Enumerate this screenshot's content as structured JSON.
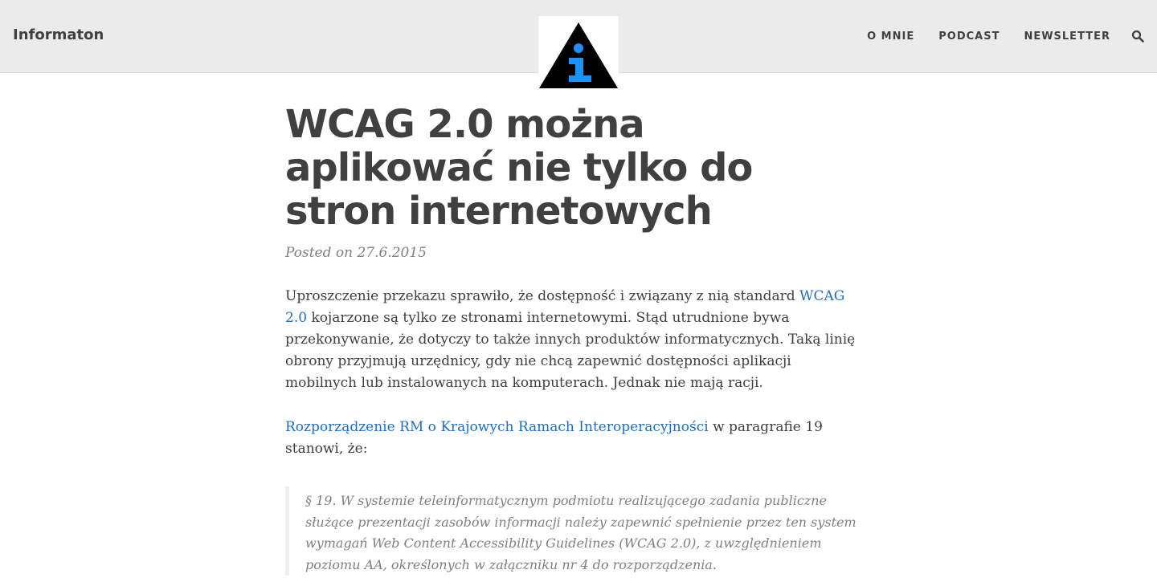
{
  "header": {
    "brand": "Informaton",
    "nav": [
      "O MNIE",
      "PODCAST",
      "NEWSLETTER"
    ],
    "search_icon": "search-icon",
    "logo_icon": "info-triangle-icon"
  },
  "post": {
    "title": "WCAG 2.0 można aplikować nie tylko do stron internetowych",
    "meta": "Posted on 27.6.2015",
    "p1": {
      "before_link": "Uproszczenie przekazu sprawiło, że dostępność i związany z nią standard ",
      "link": "WCAG 2.0",
      "after_link": " kojarzone są tylko ze stronami internetowymi. Stąd utrudnione bywa przekonywanie, że dotyczy to także innych produktów informatycznych. Taką linię obrony przyjmują urzędnicy, gdy nie chcą zapewnić dostępności aplikacji mobilnych lub instalowanych na komputerach. Jednak nie mają racji."
    },
    "p2": {
      "link": "Rozporządzenie RM o Krajowych Ramach Interoperacyjności",
      "after_link": " w paragrafie 19 stanowi, że:"
    },
    "quote": "§ 19. W systemie teleinformatycznym podmiotu realizującego zadania publiczne służące prezentacji zasobów informacji należy zapewnić spełnienie przez ten system wymagań Web Content Accessibility Guidelines (WCAG 2.0), z uwzględnieniem poziomu AA, określonych w załączniku nr 4 do rozporządzenia."
  },
  "colors": {
    "header_bg": "#ebebeb",
    "text": "#404040",
    "link": "#1f6fbf",
    "muted": "#808080",
    "logo_blue": "#1e90ff"
  }
}
